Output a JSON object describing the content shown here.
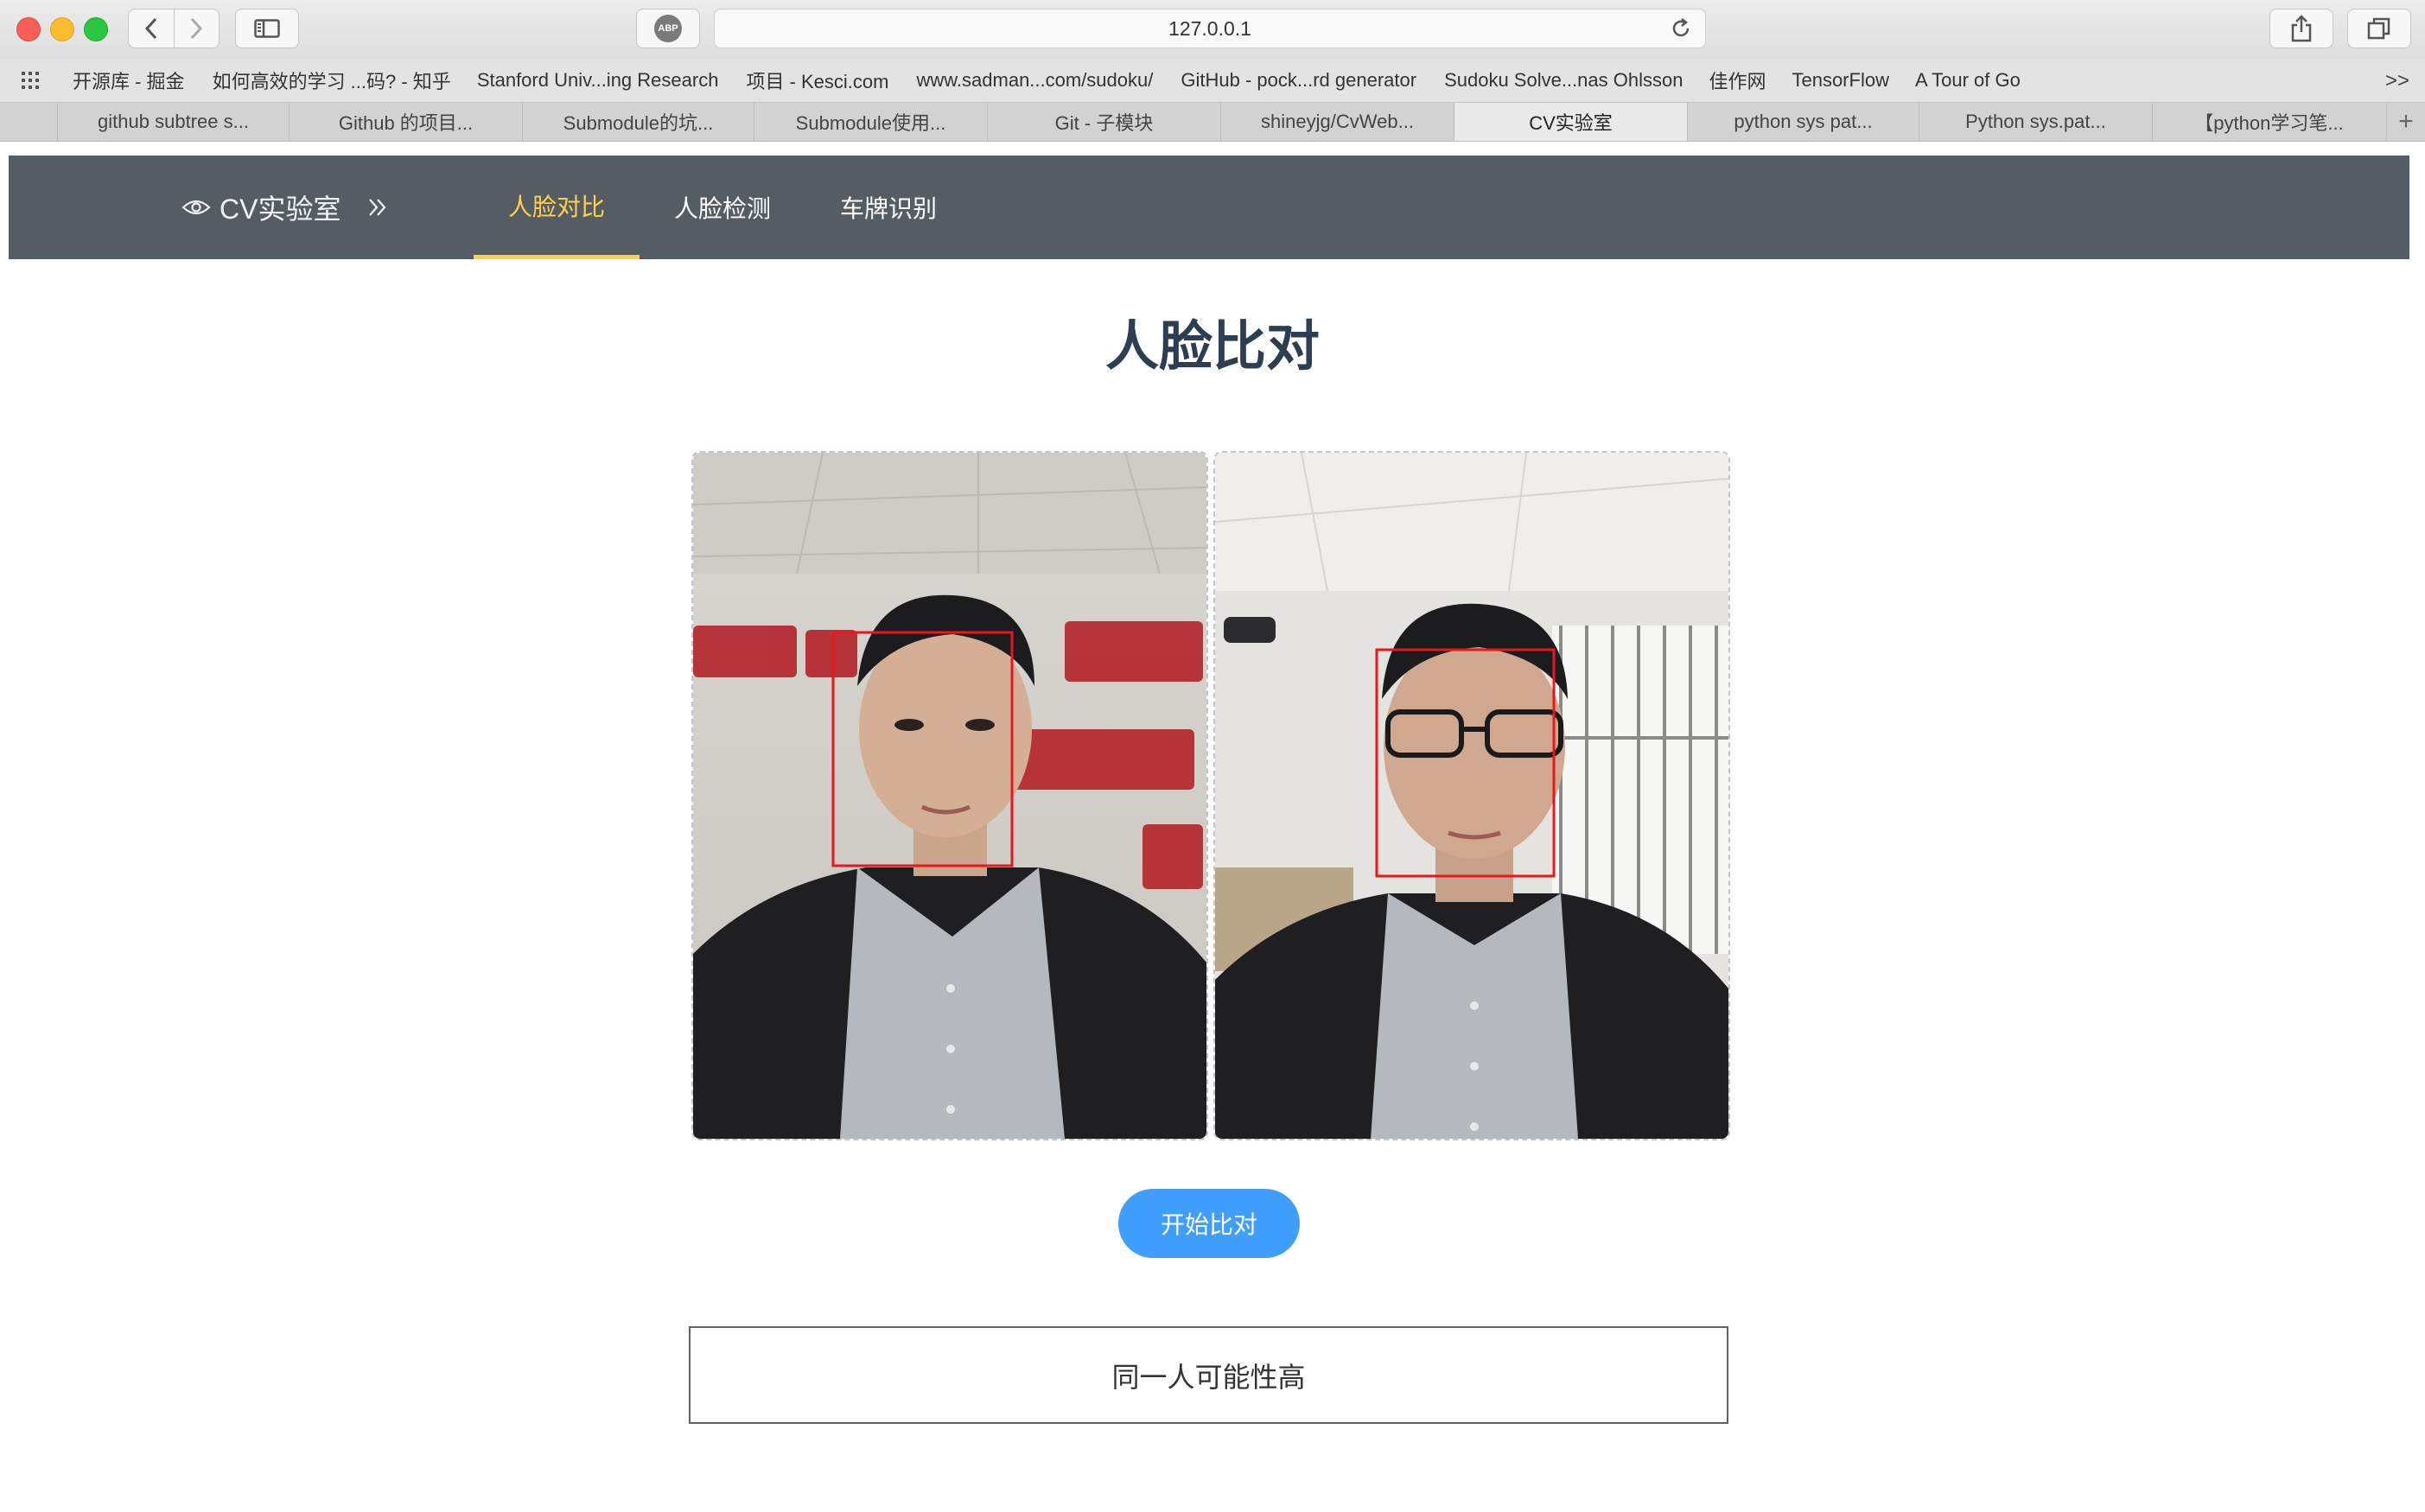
{
  "browser": {
    "url": "127.0.0.1",
    "adblock_label": "ABP",
    "bookmarks": [
      "开源库 - 掘金",
      "如何高效的学习 ...码? - 知乎",
      "Stanford Univ...ing Research",
      "项目 - Kesci.com",
      "www.sadman...com/sudoku/",
      "GitHub - pock...rd generator",
      "Sudoku Solve...nas Ohlsson",
      "佳作网",
      "TensorFlow",
      "A Tour of Go"
    ],
    "bookmarks_more": ">>",
    "tabs": [
      "github subtree s...",
      "Github 的项目...",
      "Submodule的坑...",
      "Submodule使用...",
      "Git - 子模块",
      "shineyjg/CvWeb...",
      "CV实验室",
      "python sys pat...",
      "Python sys.pat...",
      "【python学习笔..."
    ],
    "active_tab_index": 6,
    "new_tab_label": "+"
  },
  "site": {
    "brand": "CV实验室",
    "menu": [
      "人脸对比",
      "人脸检测",
      "车牌识别"
    ],
    "active_menu_index": 0,
    "accent_color": "#ffd04b",
    "nav_bg": "#545c64"
  },
  "main": {
    "title": "人脸比对",
    "compare_button": "开始比对",
    "result_text": "同一人可能性高",
    "button_color": "#409eff",
    "face_box_color": "#e8161e"
  }
}
